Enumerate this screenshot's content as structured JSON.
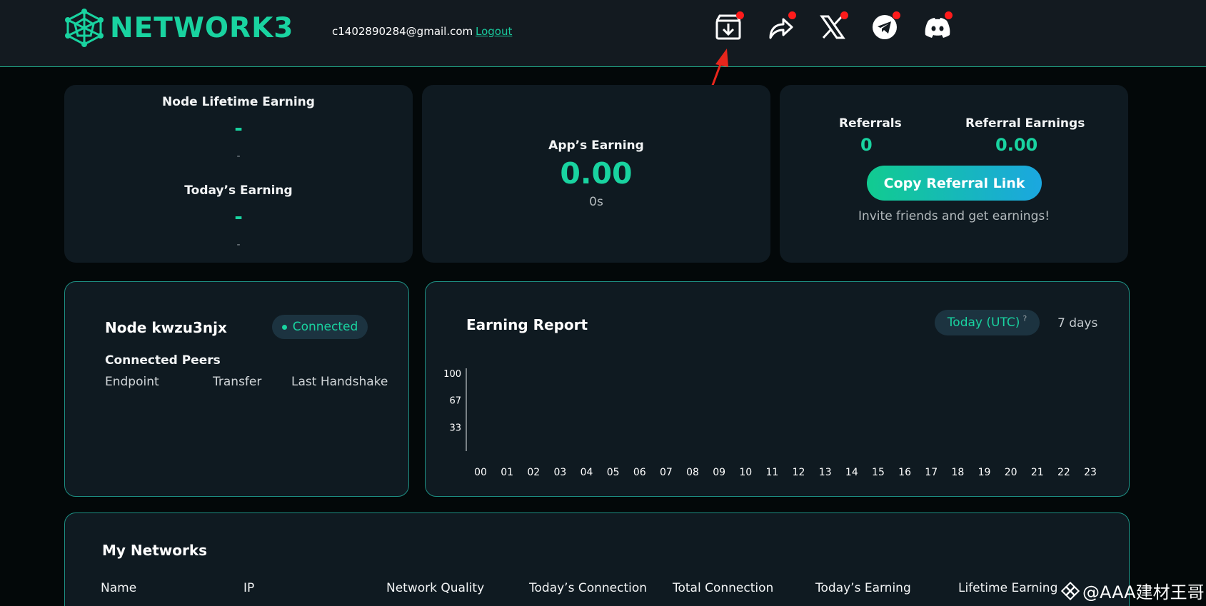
{
  "header": {
    "logo_text": "NETWORK3",
    "email": "c1402890284@gmail.com",
    "logout_label": "Logout",
    "icons": [
      "download-box-icon",
      "share-arrow-icon",
      "x-twitter-icon",
      "telegram-icon",
      "discord-icon"
    ],
    "notification_color": "#ff1b1b"
  },
  "node_earning": {
    "lifetime_label": "Node Lifetime Earning",
    "lifetime_value": "-",
    "lifetime_sub": "-",
    "today_label": "Today’s Earning",
    "today_value": "-",
    "today_sub": "-"
  },
  "app_earning": {
    "label": "App’s Earning",
    "value": "0.00",
    "time": "0s"
  },
  "referral": {
    "referrals_label": "Referrals",
    "referrals_value": "0",
    "earnings_label": "Referral Earnings",
    "earnings_value": "0.00",
    "copy_button": "Copy Referral Link",
    "invite_text": "Invite friends and get earnings!"
  },
  "node": {
    "name": "Node kwzu3njx",
    "status": "Connected",
    "peers_label": "Connected Peers",
    "columns": [
      "Endpoint",
      "Transfer",
      "Last Handshake"
    ]
  },
  "report": {
    "title": "Earning Report",
    "tab_today": "Today (UTC)",
    "tab_help": "?",
    "tab_7days": "7 days"
  },
  "chart_data": {
    "type": "bar",
    "categories": [
      "00",
      "01",
      "02",
      "03",
      "04",
      "05",
      "06",
      "07",
      "08",
      "09",
      "10",
      "11",
      "12",
      "13",
      "14",
      "15",
      "16",
      "17",
      "18",
      "19",
      "20",
      "21",
      "22",
      "23"
    ],
    "values": [],
    "yticks": [
      "100",
      "67",
      "33"
    ],
    "ylim": [
      0,
      100
    ],
    "title": "",
    "xlabel": "",
    "ylabel": ""
  },
  "networks": {
    "title": "My Networks",
    "columns": [
      "Name",
      "IP",
      "Network Quality",
      "Today’s Connection",
      "Total Connection",
      "Today’s Earning",
      "Lifetime Earning"
    ]
  },
  "watermark": {
    "text": "@AAA建材王哥"
  },
  "colors": {
    "accent": "#19d3a0",
    "annotation_arrow": "#e8261c"
  }
}
